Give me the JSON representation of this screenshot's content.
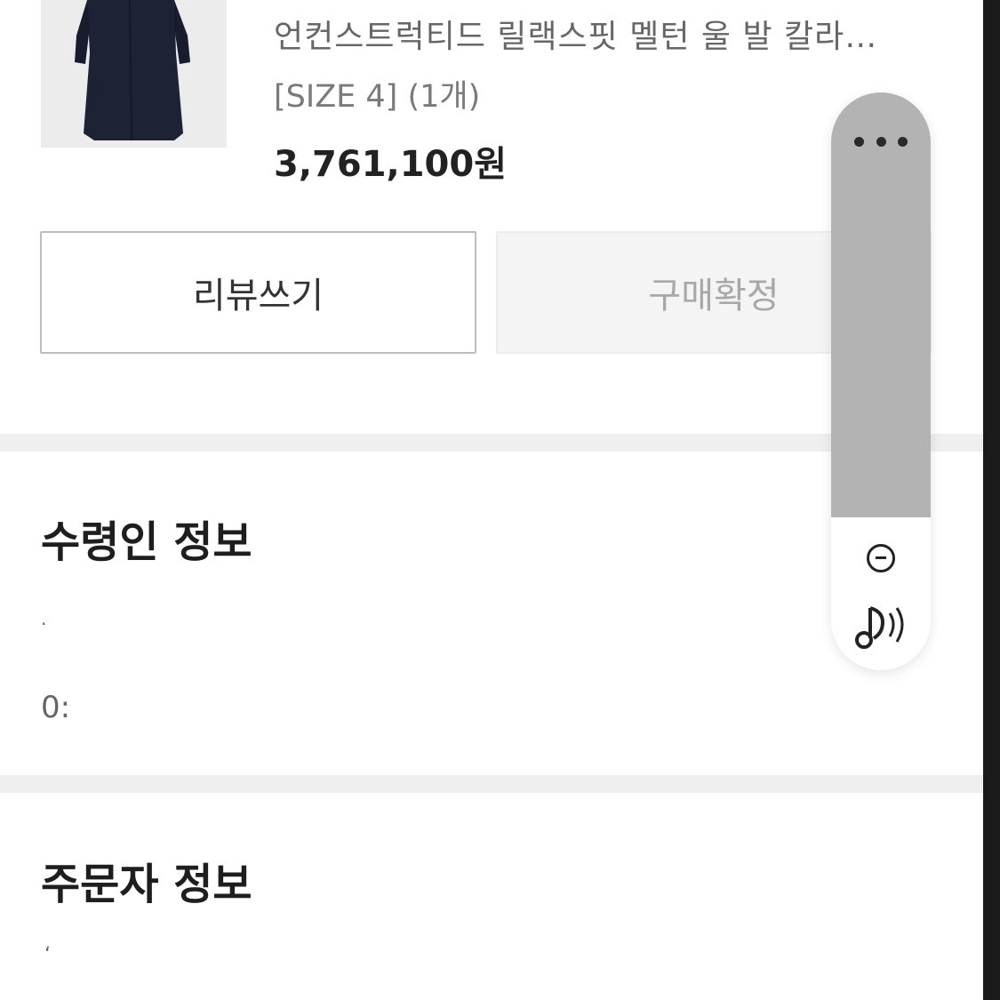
{
  "product": {
    "name": "언컨스트럭티드 릴랙스핏 멜턴 울 발 칼라…",
    "option": "[SIZE 4] (1개)",
    "price": "3,761,100원"
  },
  "actions": {
    "review_label": "리뷰쓰기",
    "confirm_label": "구매확정"
  },
  "recipient_section": {
    "title": "수령인 정보",
    "line2_partial": "0:"
  },
  "orderer_section": {
    "title": "주문자 정보"
  },
  "floating_toolbar": {
    "icons": [
      "more-icon",
      "minus-circle-icon",
      "sound-icon"
    ]
  }
}
